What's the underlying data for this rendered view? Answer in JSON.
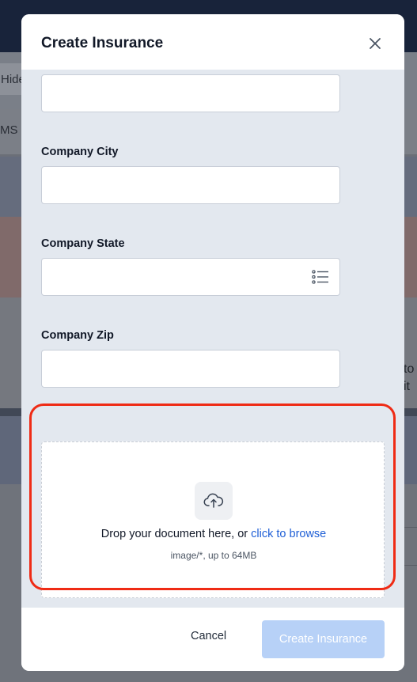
{
  "background": {
    "hide_label": "Hide",
    "tab_fragment": "MS",
    "side_text_line1": "to",
    "side_text_line2": "it"
  },
  "modal": {
    "title": "Create Insurance",
    "close_icon": "close-icon",
    "fields": [
      {
        "label": "",
        "value": ""
      },
      {
        "label": "Company City",
        "value": ""
      },
      {
        "label": "Company State",
        "value": "",
        "icon": "list-icon"
      },
      {
        "label": "Company Zip",
        "value": ""
      }
    ],
    "dropzone": {
      "icon": "cloud-upload-icon",
      "text": "Drop your document here, or ",
      "link": "click to browse",
      "hint": "image/*, up to 64MB"
    },
    "footer": {
      "cancel_label": "Cancel",
      "create_label": "Create Insurance"
    }
  },
  "colors": {
    "highlight": "#ef2b15",
    "link": "#1f5fd6",
    "primary_disabled": "#b7d1f7"
  }
}
